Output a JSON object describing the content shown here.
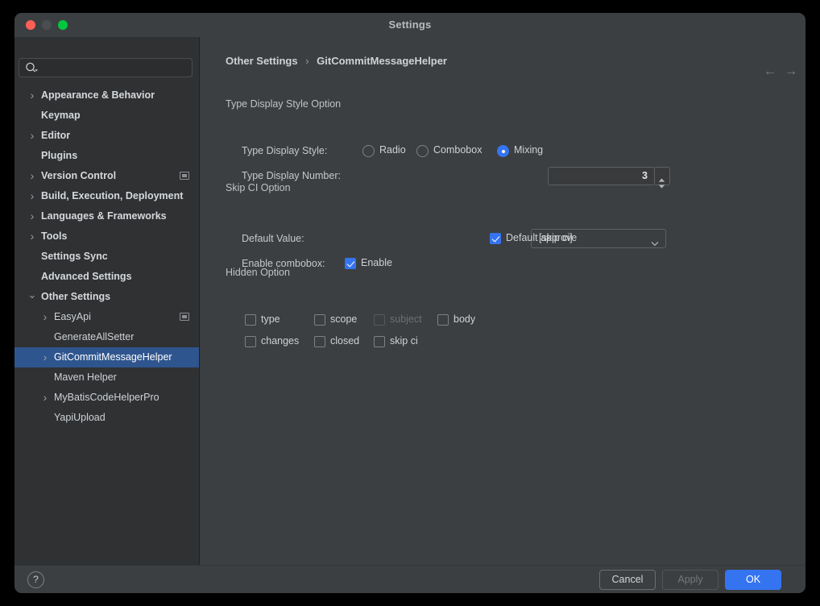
{
  "window": {
    "title": "Settings",
    "traffic_lights": [
      "close",
      "minimize",
      "maximize"
    ]
  },
  "sidebar": {
    "search": {
      "value": "",
      "placeholder": ""
    },
    "items": [
      {
        "label": "Appearance & Behavior",
        "level": 0,
        "arrow": "right",
        "bold": true,
        "badge": false,
        "selected": false
      },
      {
        "label": "Keymap",
        "level": 0,
        "arrow": "",
        "bold": true,
        "badge": false,
        "selected": false
      },
      {
        "label": "Editor",
        "level": 0,
        "arrow": "right",
        "bold": true,
        "badge": false,
        "selected": false
      },
      {
        "label": "Plugins",
        "level": 0,
        "arrow": "",
        "bold": true,
        "badge": false,
        "selected": false
      },
      {
        "label": "Version Control",
        "level": 0,
        "arrow": "right",
        "bold": true,
        "badge": true,
        "selected": false
      },
      {
        "label": "Build, Execution, Deployment",
        "level": 0,
        "arrow": "right",
        "bold": true,
        "badge": false,
        "selected": false
      },
      {
        "label": "Languages & Frameworks",
        "level": 0,
        "arrow": "right",
        "bold": true,
        "badge": false,
        "selected": false
      },
      {
        "label": "Tools",
        "level": 0,
        "arrow": "right",
        "bold": true,
        "badge": false,
        "selected": false
      },
      {
        "label": "Settings Sync",
        "level": 0,
        "arrow": "",
        "bold": true,
        "badge": false,
        "selected": false
      },
      {
        "label": "Advanced Settings",
        "level": 0,
        "arrow": "",
        "bold": true,
        "badge": false,
        "selected": false
      },
      {
        "label": "Other Settings",
        "level": 0,
        "arrow": "down",
        "bold": true,
        "badge": false,
        "selected": false
      },
      {
        "label": "EasyApi",
        "level": 1,
        "arrow": "right",
        "bold": false,
        "badge": true,
        "selected": false
      },
      {
        "label": "GenerateAllSetter",
        "level": 1,
        "arrow": "",
        "bold": false,
        "badge": false,
        "selected": false
      },
      {
        "label": "GitCommitMessageHelper",
        "level": 1,
        "arrow": "right",
        "bold": false,
        "badge": false,
        "selected": true
      },
      {
        "label": "Maven Helper",
        "level": 1,
        "arrow": "",
        "bold": false,
        "badge": false,
        "selected": false
      },
      {
        "label": "MyBatisCodeHelperPro",
        "level": 1,
        "arrow": "right",
        "bold": false,
        "badge": false,
        "selected": false
      },
      {
        "label": "YapiUpload",
        "level": 1,
        "arrow": "",
        "bold": false,
        "badge": false,
        "selected": false
      }
    ]
  },
  "main": {
    "breadcrumb": {
      "parent": "Other Settings",
      "separator": "›",
      "current": "GitCommitMessageHelper"
    },
    "nav": {
      "back_icon": "←",
      "forward_icon": "→"
    },
    "sections": {
      "type_display": {
        "title": "Type Display Style Option",
        "style_label": "Type Display Style:",
        "options": [
          {
            "label": "Radio",
            "selected": false
          },
          {
            "label": "Combobox",
            "selected": false
          },
          {
            "label": "Mixing",
            "selected": true
          }
        ],
        "number_label": "Type Display Number:",
        "number_value": "3"
      },
      "skip_ci": {
        "title": "Skip CI Option",
        "default_value_label": "Default Value:",
        "default_value": "[skip ci]",
        "default_approve": {
          "label": "Default approve",
          "checked": true
        },
        "enable_combobox_label": "Enable combobox:",
        "enable": {
          "label": "Enable",
          "checked": true
        }
      },
      "hidden": {
        "title": "Hidden Option",
        "row1": [
          {
            "label": "type",
            "checked": false,
            "disabled": false
          },
          {
            "label": "scope",
            "checked": false,
            "disabled": false
          },
          {
            "label": "subject",
            "checked": false,
            "disabled": true
          },
          {
            "label": "body",
            "checked": false,
            "disabled": false
          }
        ],
        "row2": [
          {
            "label": "changes",
            "checked": false,
            "disabled": false
          },
          {
            "label": "closed",
            "checked": false,
            "disabled": false
          },
          {
            "label": "skip ci",
            "checked": false,
            "disabled": false
          }
        ]
      }
    }
  },
  "footer": {
    "help_label": "?",
    "cancel_label": "Cancel",
    "apply_label": "Apply",
    "apply_disabled": true,
    "ok_label": "OK"
  },
  "colors": {
    "accent": "#3574f0",
    "selection": "#2f558e",
    "window_bg": "#3c3f41",
    "sidebar_bg": "#2f3133"
  }
}
